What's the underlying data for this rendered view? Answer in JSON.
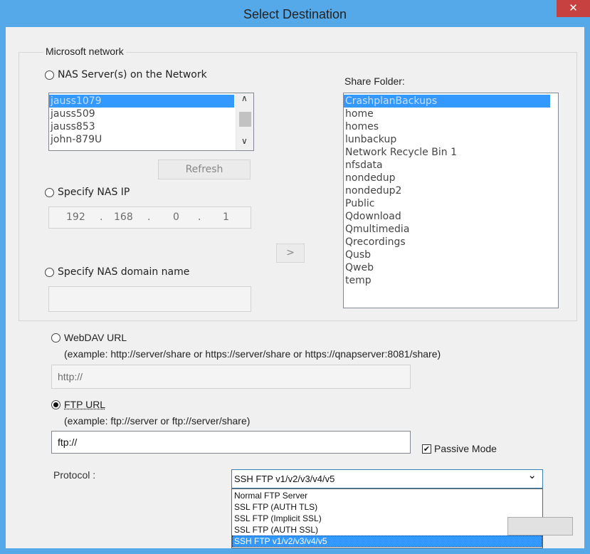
{
  "window": {
    "title": "Select Destination",
    "close_glyph": "✕"
  },
  "microsoft_network": {
    "group_label": "Microsoft network",
    "nas_servers_label": "NAS Server(s) on the Network",
    "servers": [
      {
        "name": "jauss1079",
        "selected": true
      },
      {
        "name": "jauss509",
        "selected": false
      },
      {
        "name": "jauss853",
        "selected": false
      },
      {
        "name": "john-879U",
        "selected": false
      }
    ],
    "refresh_label": "Refresh",
    "specify_ip_label": "Specify NAS IP",
    "ip": {
      "o1": "192",
      "o2": "168",
      "o3": "0",
      "o4": "1",
      "dot": "."
    },
    "arrow_label": ">",
    "specify_domain_label": "Specify NAS domain name",
    "domain_value": "",
    "share_folder_label": "Share Folder:",
    "share_folders": [
      {
        "name": "CrashplanBackups",
        "selected": true
      },
      {
        "name": "home",
        "selected": false
      },
      {
        "name": "homes",
        "selected": false
      },
      {
        "name": "lunbackup",
        "selected": false
      },
      {
        "name": "Network Recycle Bin 1",
        "selected": false
      },
      {
        "name": "nfsdata",
        "selected": false
      },
      {
        "name": "nondedup",
        "selected": false
      },
      {
        "name": "nondedup2",
        "selected": false
      },
      {
        "name": "Public",
        "selected": false
      },
      {
        "name": "Qdownload",
        "selected": false
      },
      {
        "name": "Qmultimedia",
        "selected": false
      },
      {
        "name": "Qrecordings",
        "selected": false
      },
      {
        "name": "Qusb",
        "selected": false
      },
      {
        "name": "Qweb",
        "selected": false
      },
      {
        "name": "temp",
        "selected": false
      }
    ]
  },
  "webdav": {
    "label": "WebDAV URL",
    "example": "(example: http://server/share or https://server/share or https://qnapserver:8081/share)",
    "value": "http://"
  },
  "ftp": {
    "label": "FTP URL",
    "example": "(example: ftp://server or ftp://server/share)",
    "value": "ftp://",
    "passive_mode_label": "Passive Mode",
    "passive_mode_checked": true,
    "check_glyph": "✔"
  },
  "protocol": {
    "label": "Protocol :",
    "selected": "SSH FTP v1/v2/v3/v4/v5",
    "chevron": "⌄",
    "options": [
      {
        "label": "Normal FTP Server",
        "selected": false
      },
      {
        "label": "SSL FTP (AUTH TLS)",
        "selected": false
      },
      {
        "label": "SSL FTP (Implicit SSL)",
        "selected": false
      },
      {
        "label": "SSL FTP (AUTH SSL)",
        "selected": false
      },
      {
        "label": "SSH FTP v1/v2/v3/v4/v5",
        "selected": true
      }
    ]
  },
  "scroll_glyphs": {
    "up": "∧",
    "down": "∨"
  }
}
